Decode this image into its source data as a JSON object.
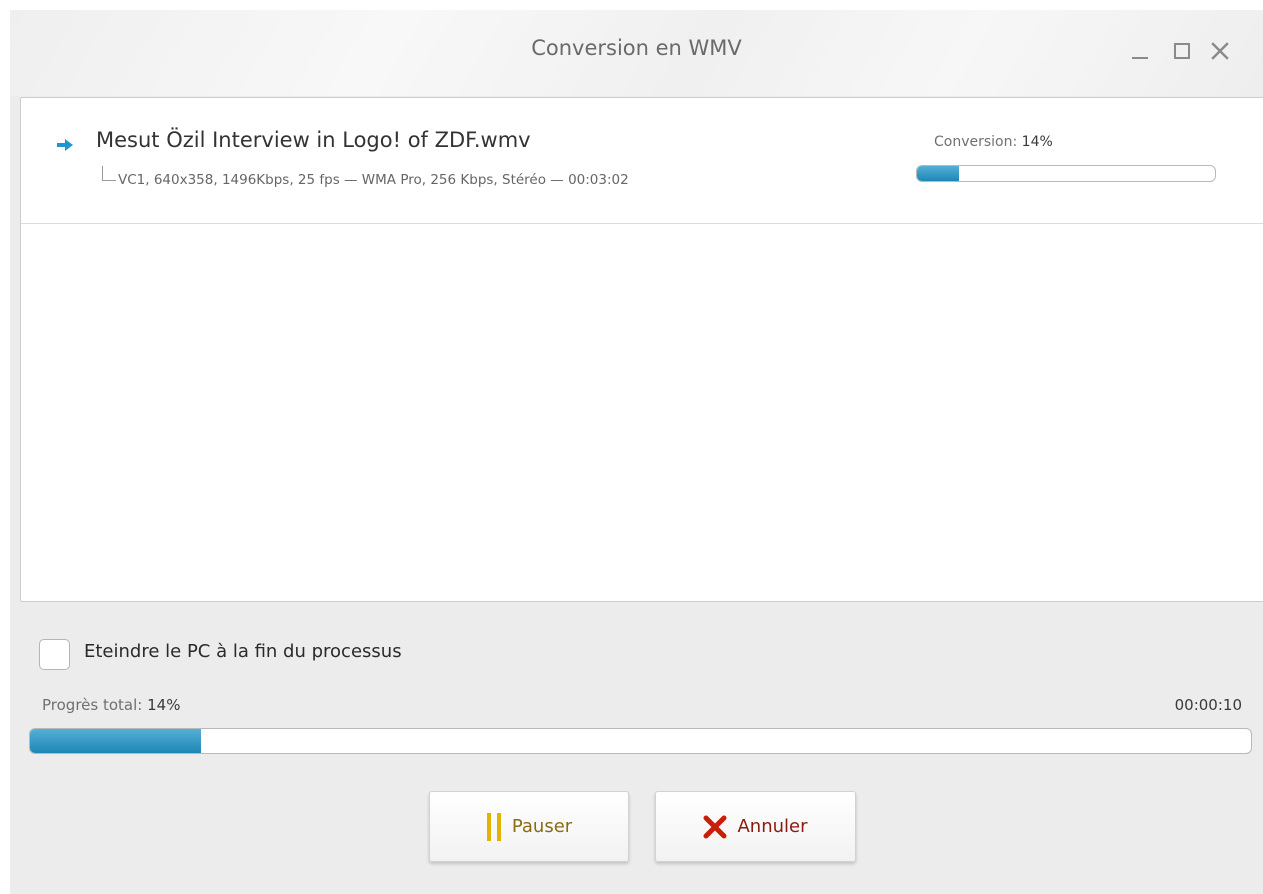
{
  "window": {
    "title": "Conversion en WMV"
  },
  "file": {
    "name": "Mesut Özil Interview in Logo! of ZDF.wmv",
    "info": "VC1, 640x358, 1496Kbps, 25 fps — WMA Pro, 256 Kbps, Stéréo — 00:03:02",
    "progress_label": "Conversion:",
    "progress_value": "14%",
    "progress_fraction": 0.14
  },
  "shutdown": {
    "label": "Eteindre le PC à la fin du processus",
    "checked": false
  },
  "total": {
    "label": "Progrès total:",
    "value": "14%",
    "progress_fraction": 0.14,
    "elapsed": "00:00:10"
  },
  "buttons": {
    "pause_label": "Pauser",
    "cancel_label": "Annuler"
  },
  "icons": {
    "arrow": "arrow-right-icon",
    "pause": "pause-icon",
    "cancel": "x-icon",
    "minimize": "minimize-icon",
    "maximize": "maximize-icon",
    "close": "close-icon"
  },
  "colors": {
    "accent": "#1e86b6",
    "pause": "#e2b400",
    "cancel": "#c81e0a"
  }
}
